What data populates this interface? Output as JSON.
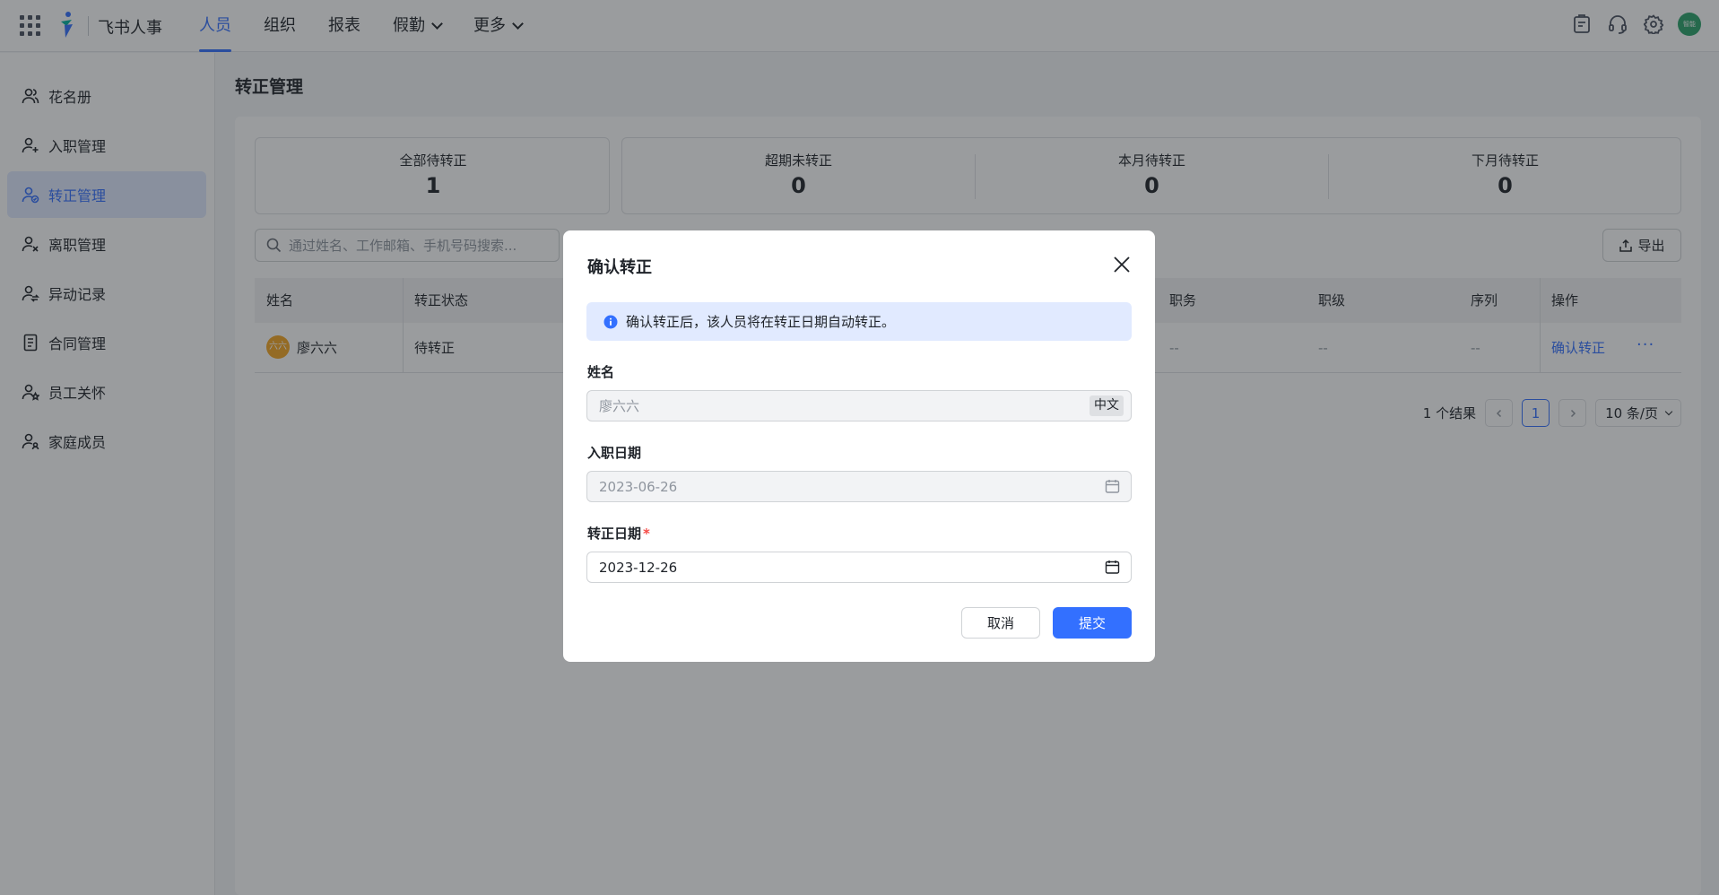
{
  "app": {
    "name": "飞书人事"
  },
  "nav": [
    {
      "label": "人员",
      "active": true,
      "dropdown": false
    },
    {
      "label": "组织",
      "active": false,
      "dropdown": false
    },
    {
      "label": "报表",
      "active": false,
      "dropdown": false
    },
    {
      "label": "假勤",
      "active": false,
      "dropdown": true
    },
    {
      "label": "更多",
      "active": false,
      "dropdown": true
    }
  ],
  "topicons": [
    "clipboard-icon",
    "headset-icon",
    "gear-icon"
  ],
  "user": {
    "avatar_text": "智能",
    "avatar_color": "#2aa36b"
  },
  "sidebar": {
    "items": [
      {
        "label": "花名册",
        "icon": "users-icon",
        "active": false
      },
      {
        "label": "入职管理",
        "icon": "user-add-icon",
        "active": false
      },
      {
        "label": "转正管理",
        "icon": "user-check-icon",
        "active": true
      },
      {
        "label": "离职管理",
        "icon": "user-remove-icon",
        "active": false
      },
      {
        "label": "异动记录",
        "icon": "user-transfer-icon",
        "active": false
      },
      {
        "label": "合同管理",
        "icon": "document-icon",
        "active": false
      },
      {
        "label": "员工关怀",
        "icon": "user-star-icon",
        "active": false
      },
      {
        "label": "家庭成员",
        "icon": "family-icon",
        "active": false
      }
    ]
  },
  "page": {
    "title": "转正管理"
  },
  "stats": [
    {
      "label": "全部待转正",
      "value": "1"
    },
    {
      "label": "超期未转正",
      "value": "0"
    },
    {
      "label": "本月待转正",
      "value": "0"
    },
    {
      "label": "下月待转正",
      "value": "0"
    }
  ],
  "search": {
    "placeholder": "通过姓名、工作邮箱、手机号码搜索..."
  },
  "export": {
    "label": "导出"
  },
  "table": {
    "columns": [
      "姓名",
      "转正状态",
      "职务",
      "职级",
      "序列",
      "操作"
    ],
    "rows": [
      {
        "avatar_text": "六六",
        "name": "廖六六",
        "status": "待转正",
        "position": "--",
        "level": "--",
        "sequence": "--",
        "action": "确认转正",
        "more": "···"
      }
    ]
  },
  "pagination": {
    "total": "1 个结果",
    "current": "1",
    "page_size": "10 条/页"
  },
  "modal": {
    "title": "确认转正",
    "notice": "确认转正后，该人员将在转正日期自动转正。",
    "name_label": "姓名",
    "name_value": "廖六六",
    "lang_tag": "中文",
    "join_date_label": "入职日期",
    "join_date_value": "2023-06-26",
    "regular_date_label": "转正日期",
    "required_mark": "*",
    "regular_date_value": "2023-12-26",
    "cancel_label": "取消",
    "submit_label": "提交"
  },
  "colors": {
    "accent": "#3370ff",
    "overlay": "rgba(31,35,41,0.45)"
  }
}
